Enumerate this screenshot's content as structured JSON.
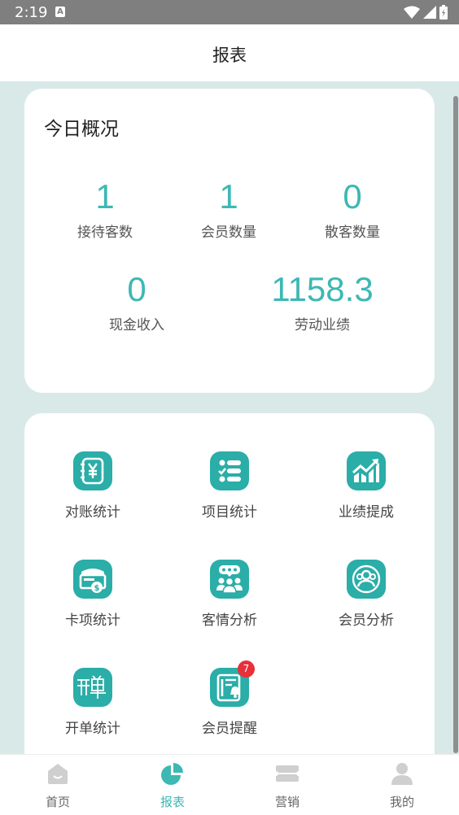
{
  "status_bar": {
    "time": "2:19",
    "notification_glyph": "A"
  },
  "header": {
    "title": "报表"
  },
  "overview": {
    "title": "今日概况",
    "stats": [
      {
        "value": "1",
        "label": "接待客数"
      },
      {
        "value": "1",
        "label": "会员数量"
      },
      {
        "value": "0",
        "label": "散客数量"
      },
      {
        "value": "0",
        "label": "现金收入"
      },
      {
        "value": "1158.3",
        "label": "劳动业绩"
      }
    ]
  },
  "menu": {
    "items": [
      {
        "label": "对账统计",
        "icon": "ledger-yen-icon"
      },
      {
        "label": "项目统计",
        "icon": "checklist-icon"
      },
      {
        "label": "业绩提成",
        "icon": "trend-up-icon"
      },
      {
        "label": "卡项统计",
        "icon": "card-coin-icon"
      },
      {
        "label": "客情分析",
        "icon": "customer-rating-icon"
      },
      {
        "label": "会员分析",
        "icon": "members-icon"
      },
      {
        "label": "开单统计",
        "icon": "open-order-icon"
      },
      {
        "label": "会员提醒",
        "icon": "bell-reminder-icon",
        "badge": "7"
      }
    ]
  },
  "tabs": [
    {
      "label": "首页",
      "icon": "home-icon",
      "active": false
    },
    {
      "label": "报表",
      "icon": "pie-chart-icon",
      "active": true
    },
    {
      "label": "营销",
      "icon": "ticket-icon",
      "active": false
    },
    {
      "label": "我的",
      "icon": "user-icon",
      "active": false
    }
  ],
  "colors": {
    "accent": "#3db8b4",
    "icon_tile": "#2bada8",
    "background": "#d8e9e8",
    "badge": "#e8303a",
    "inactive_icon": "#cfcfcf"
  }
}
